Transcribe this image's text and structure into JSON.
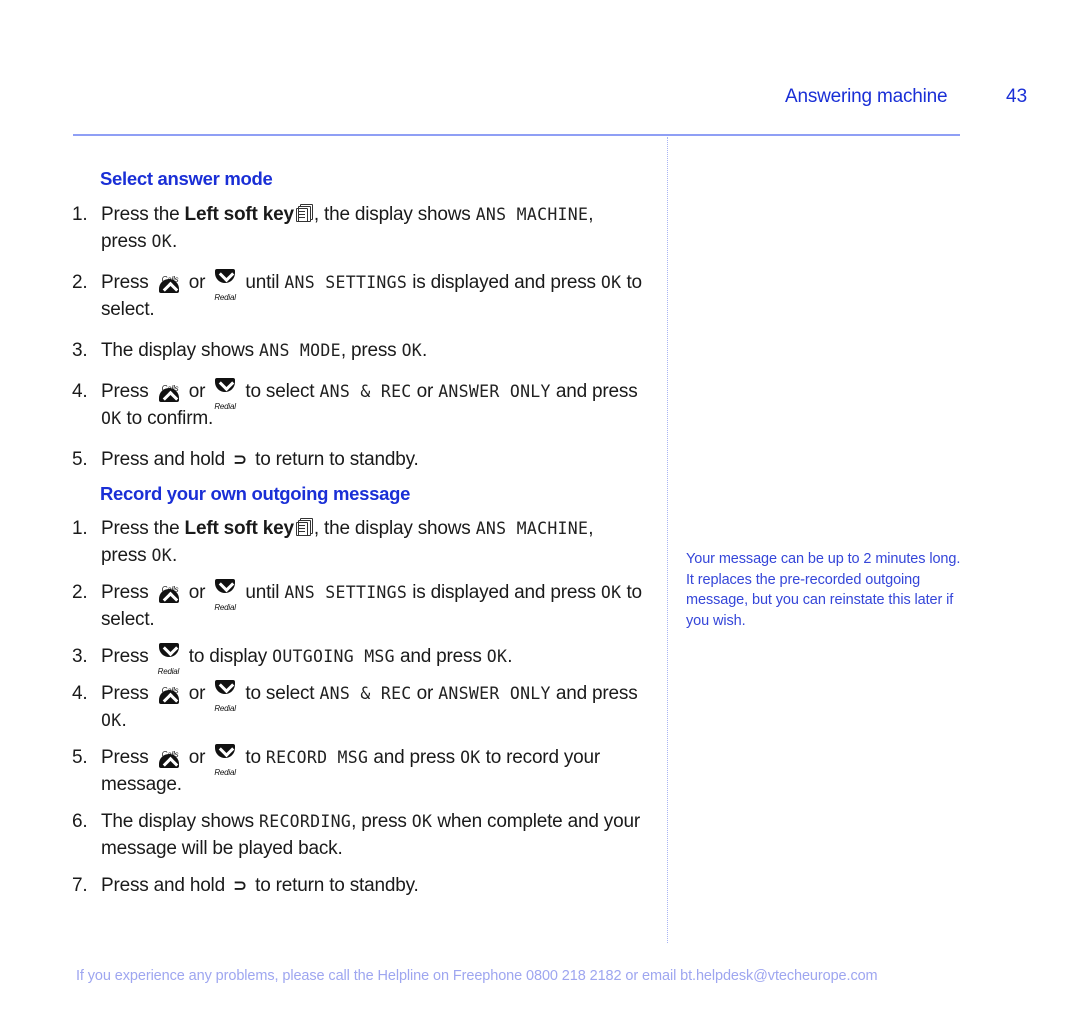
{
  "header": {
    "section_title": "Answering machine",
    "page_number": "43"
  },
  "sections": [
    {
      "heading": "Select answer mode",
      "steps": [
        {
          "num": "1.",
          "parts": [
            {
              "t": "text",
              "v": "Press the "
            },
            {
              "t": "bold",
              "v": "Left soft key"
            },
            {
              "t": "icon",
              "v": "left-soft-key-icon"
            },
            {
              "t": "text",
              "v": ", the display shows "
            },
            {
              "t": "lcd",
              "v": "ANS MACHINE"
            },
            {
              "t": "text",
              "v": ", press "
            },
            {
              "t": "lcd",
              "v": "OK"
            },
            {
              "t": "text",
              "v": "."
            }
          ]
        },
        {
          "num": "2.",
          "parts": [
            {
              "t": "text",
              "v": "Press "
            },
            {
              "t": "icon",
              "v": "calls-up-icon"
            },
            {
              "t": "text",
              "v": " or "
            },
            {
              "t": "icon",
              "v": "redial-down-icon"
            },
            {
              "t": "text",
              "v": " until "
            },
            {
              "t": "lcd",
              "v": "ANS SETTINGS"
            },
            {
              "t": "text",
              "v": " is displayed and press "
            },
            {
              "t": "lcd",
              "v": "OK"
            },
            {
              "t": "text",
              "v": " to select."
            }
          ]
        },
        {
          "num": "3.",
          "parts": [
            {
              "t": "text",
              "v": "The display shows "
            },
            {
              "t": "lcd",
              "v": "ANS MODE"
            },
            {
              "t": "text",
              "v": ", press "
            },
            {
              "t": "lcd",
              "v": "OK"
            },
            {
              "t": "text",
              "v": "."
            }
          ]
        },
        {
          "num": "4.",
          "parts": [
            {
              "t": "text",
              "v": "Press "
            },
            {
              "t": "icon",
              "v": "calls-up-icon"
            },
            {
              "t": "text",
              "v": " or "
            },
            {
              "t": "icon",
              "v": "redial-down-icon"
            },
            {
              "t": "text",
              "v": " to select "
            },
            {
              "t": "lcd",
              "v": "ANS & REC"
            },
            {
              "t": "text",
              "v": " or "
            },
            {
              "t": "lcd",
              "v": "ANSWER ONLY"
            },
            {
              "t": "text",
              "v": " and press "
            },
            {
              "t": "lcd",
              "v": "OK"
            },
            {
              "t": "text",
              "v": " to confirm."
            }
          ]
        },
        {
          "num": "5.",
          "parts": [
            {
              "t": "text",
              "v": "Press and hold "
            },
            {
              "t": "icon",
              "v": "back-icon"
            },
            {
              "t": "text",
              "v": " to return to standby."
            }
          ]
        }
      ]
    },
    {
      "heading": "Record your own outgoing message",
      "steps": [
        {
          "num": "1.",
          "parts": [
            {
              "t": "text",
              "v": "Press the "
            },
            {
              "t": "bold",
              "v": "Left soft key"
            },
            {
              "t": "icon",
              "v": "left-soft-key-icon"
            },
            {
              "t": "text",
              "v": ", the display shows "
            },
            {
              "t": "lcd",
              "v": "ANS MACHINE"
            },
            {
              "t": "text",
              "v": ", press "
            },
            {
              "t": "lcd",
              "v": "OK"
            },
            {
              "t": "text",
              "v": "."
            }
          ]
        },
        {
          "num": "2.",
          "parts": [
            {
              "t": "text",
              "v": "Press "
            },
            {
              "t": "icon",
              "v": "calls-up-icon"
            },
            {
              "t": "text",
              "v": " or "
            },
            {
              "t": "icon",
              "v": "redial-down-icon"
            },
            {
              "t": "text",
              "v": " until "
            },
            {
              "t": "lcd",
              "v": "ANS SETTINGS"
            },
            {
              "t": "text",
              "v": " is displayed and press "
            },
            {
              "t": "lcd",
              "v": "OK"
            },
            {
              "t": "text",
              "v": " to select."
            }
          ]
        },
        {
          "num": "3.",
          "parts": [
            {
              "t": "text",
              "v": "Press "
            },
            {
              "t": "icon",
              "v": "redial-down-icon"
            },
            {
              "t": "text",
              "v": " to display "
            },
            {
              "t": "lcd",
              "v": "OUTGOING MSG"
            },
            {
              "t": "text",
              "v": " and press "
            },
            {
              "t": "lcd",
              "v": "OK"
            },
            {
              "t": "text",
              "v": "."
            }
          ]
        },
        {
          "num": "4.",
          "parts": [
            {
              "t": "text",
              "v": "Press "
            },
            {
              "t": "icon",
              "v": "calls-up-icon"
            },
            {
              "t": "text",
              "v": " or "
            },
            {
              "t": "icon",
              "v": "redial-down-icon"
            },
            {
              "t": "text",
              "v": " to select "
            },
            {
              "t": "lcd",
              "v": "ANS & REC"
            },
            {
              "t": "text",
              "v": " or "
            },
            {
              "t": "lcd",
              "v": "ANSWER ONLY"
            },
            {
              "t": "text",
              "v": " and press "
            },
            {
              "t": "lcd",
              "v": "OK"
            },
            {
              "t": "text",
              "v": "."
            }
          ]
        },
        {
          "num": "5.",
          "parts": [
            {
              "t": "text",
              "v": "Press "
            },
            {
              "t": "icon",
              "v": "calls-up-icon"
            },
            {
              "t": "text",
              "v": " or "
            },
            {
              "t": "icon",
              "v": "redial-down-icon"
            },
            {
              "t": "text",
              "v": " to "
            },
            {
              "t": "lcd",
              "v": "RECORD MSG"
            },
            {
              "t": "text",
              "v": " and press "
            },
            {
              "t": "lcd",
              "v": "OK"
            },
            {
              "t": "text",
              "v": " to record your message."
            }
          ]
        },
        {
          "num": "6.",
          "parts": [
            {
              "t": "text",
              "v": "The display shows "
            },
            {
              "t": "lcd",
              "v": "RECORDING"
            },
            {
              "t": "text",
              "v": ", press "
            },
            {
              "t": "lcd",
              "v": "OK"
            },
            {
              "t": "text",
              "v": " when complete and your message will be played back."
            }
          ]
        },
        {
          "num": "7.",
          "parts": [
            {
              "t": "text",
              "v": "Press and hold "
            },
            {
              "t": "icon",
              "v": "back-icon"
            },
            {
              "t": "text",
              "v": " to return to standby."
            }
          ]
        }
      ]
    }
  ],
  "icon_labels": {
    "calls": "Calls",
    "redial": "Redial",
    "back_glyph": "⊃"
  },
  "sidebar_note": "Your message can be up to 2 minutes long. It replaces the pre-recorded outgoing message, but you can reinstate this later if you wish.",
  "footer": "If you experience any problems, please call the Helpline on Freephone 0800 218 2182 or email bt.helpdesk@vtecheurope.com",
  "colors": {
    "accent": "#1a2fd6",
    "rule": "#8f9ff5",
    "sidebar_text": "#3546d9",
    "footer_text": "#9ea6f0"
  }
}
